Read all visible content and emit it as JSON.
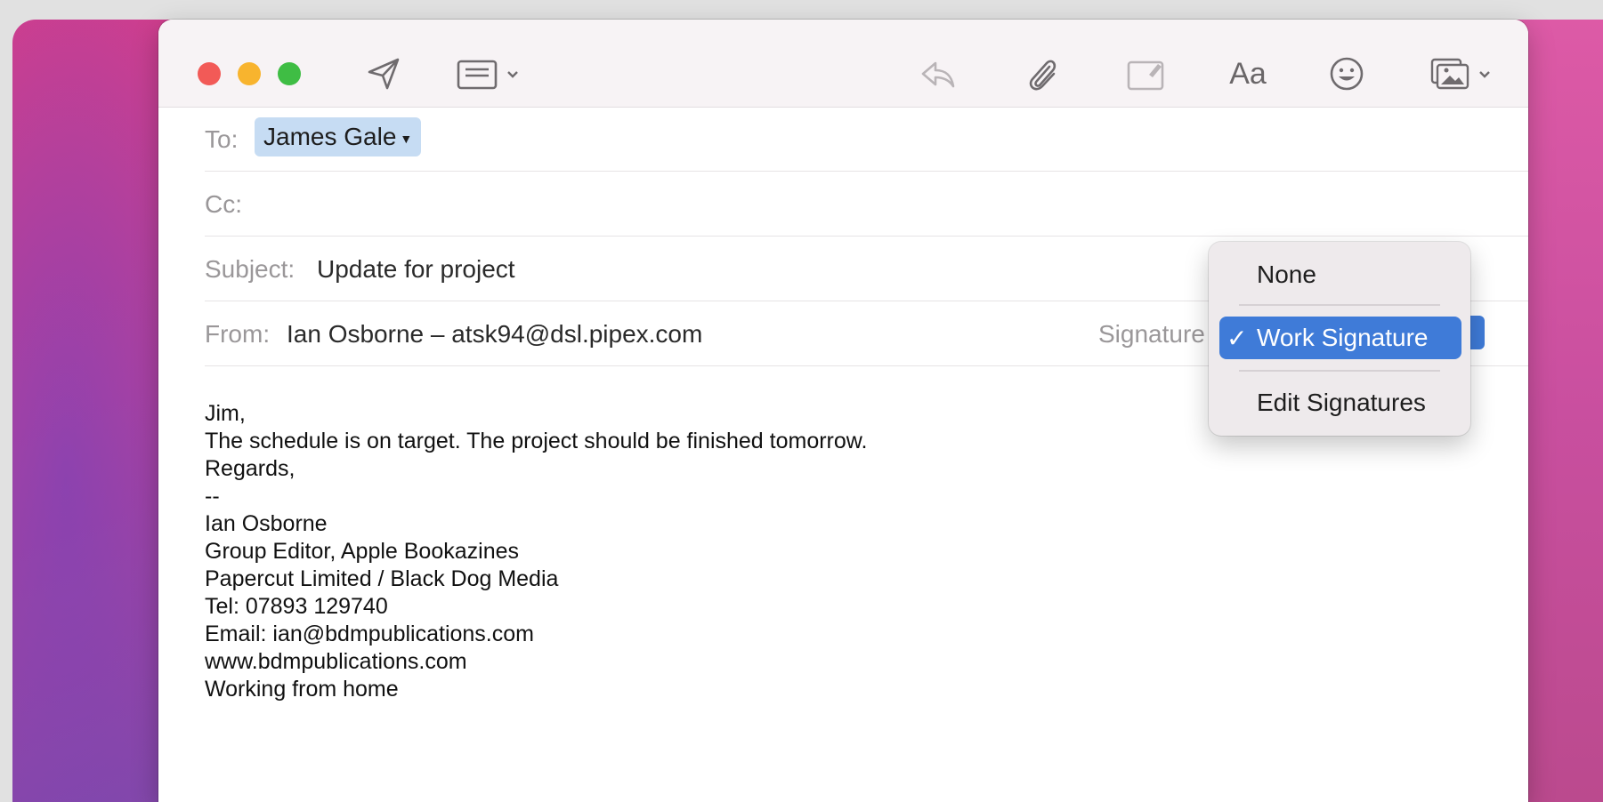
{
  "toolbar": {
    "icons": [
      "send-icon",
      "header-fields-icon",
      "reply-icon",
      "attachment-icon",
      "markup-icon",
      "format-icon",
      "emoji-icon",
      "photo-browser-icon"
    ],
    "format_label": "Aa"
  },
  "compose": {
    "to_label": "To:",
    "to_recipient": "James Gale",
    "cc_label": "Cc:",
    "subject_label": "Subject:",
    "subject_value": "Update for project",
    "from_label": "From:",
    "from_value": "Ian Osborne – atsk94@dsl.pipex.com",
    "signature_label": "Signature"
  },
  "signature_menu": {
    "items": [
      {
        "label": "None",
        "selected": false
      },
      {
        "label": "Work Signature",
        "selected": true
      },
      {
        "label": "Edit Signatures",
        "selected": false
      }
    ],
    "check": "✓"
  },
  "message": {
    "lines": [
      "Jim,",
      "",
      "The schedule is on target. The project should be finished tomorrow.",
      "",
      "Regards,",
      "--",
      "Ian Osborne",
      "Group Editor, Apple Bookazines",
      "Papercut Limited / Black Dog Media",
      "",
      "Tel: 07893 129740",
      "Email: ian@bdmpublications.com",
      "www.bdmpublications.com",
      "",
      "Working from home"
    ]
  },
  "colors": {
    "accent": "#3f7bd8",
    "recipient_token": "#c6dcf3",
    "close": "#f25a57",
    "minimize": "#f8b42e",
    "zoom": "#3fbd44"
  }
}
